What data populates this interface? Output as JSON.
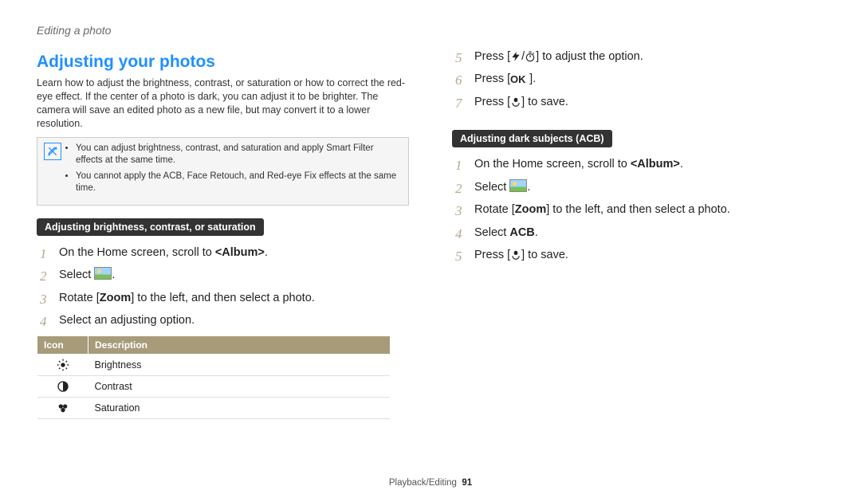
{
  "breadcrumb": "Editing a photo",
  "section_title": "Adjusting your photos",
  "intro": "Learn how to adjust the brightness, contrast, or saturation or how to correct the red-eye effect. If the center of a photo is dark, you can adjust it to be brighter. The camera will save an edited photo as a new file, but may convert it to a lower resolution.",
  "notes": [
    "You can adjust brightness, contrast, and saturation and apply Smart Filter effects at the same time.",
    "You cannot apply the ACB, Face Retouch, and Red-eye Fix effects at the same time."
  ],
  "sub1": "Adjusting brightness, contrast, or saturation",
  "left_steps": {
    "s1_a": "On the Home screen, scroll to ",
    "s1_b": "<Album>",
    "s1_c": ".",
    "s2_a": "Select ",
    "s2_c": ".",
    "s3_a": "Rotate [",
    "s3_b": "Zoom",
    "s3_c": "] to the left, and then select a photo.",
    "s4": "Select an adjusting option."
  },
  "table": {
    "h1": "Icon",
    "h2": "Description",
    "rows": [
      {
        "icon": "brightness",
        "desc": "Brightness"
      },
      {
        "icon": "contrast",
        "desc": "Contrast"
      },
      {
        "icon": "saturation",
        "desc": "Saturation"
      }
    ]
  },
  "right_top": {
    "s5_a": "Press [",
    "s5_b": "] to adjust the option.",
    "s6_a": "Press [",
    "s6_b": "].",
    "s7_a": "Press [",
    "s7_b": "] to save."
  },
  "sub2": "Adjusting dark subjects (ACB)",
  "right_steps": {
    "s1_a": "On the Home screen, scroll to ",
    "s1_b": "<Album>",
    "s1_c": ".",
    "s2_a": "Select ",
    "s2_c": ".",
    "s3_a": "Rotate [",
    "s3_b": "Zoom",
    "s3_c": "] to the left, and then select a photo.",
    "s4_a": "Select ",
    "s4_b": "ACB",
    "s4_c": ".",
    "s5_a": "Press [",
    "s5_b": "] to save."
  },
  "footer_label": "Playback/Editing",
  "footer_page": "91"
}
